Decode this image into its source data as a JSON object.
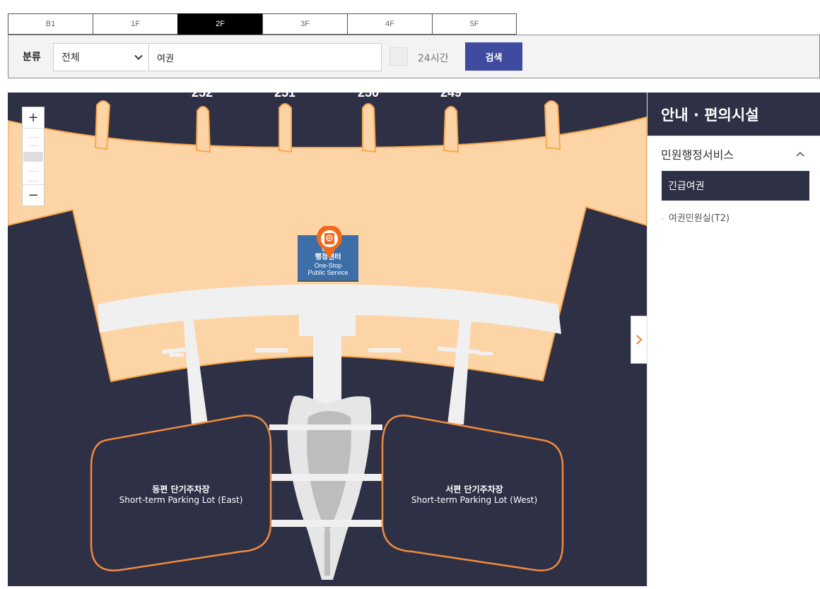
{
  "floors": [
    "B1",
    "1F",
    "2F",
    "3F",
    "4F",
    "5F"
  ],
  "active_floor": "2F",
  "search": {
    "label": "분류",
    "category": "전체",
    "query": "여권",
    "option_24h": "24시간",
    "button": "검색"
  },
  "map": {
    "zoom_in": "+",
    "zoom_out": "−",
    "gates": [
      "252",
      "251",
      "250",
      "249"
    ],
    "poi": {
      "name_ko_line1": "통합",
      "name_ko_line2": "행정센터",
      "name_en_line1": "One-Stop",
      "name_en_line2": "Public Service"
    },
    "parking_east": {
      "ko": "동편 단기주차장",
      "en": "Short-term Parking Lot (East)"
    },
    "parking_west": {
      "ko": "서편 단기주차장",
      "en": "Short-term Parking Lot (West)"
    },
    "colors": {
      "background": "#2e3046",
      "terminal": "#fdd4a6",
      "outline": "#f6a84f",
      "parking_outline": "#f08a3c",
      "road": "#f0f0f0",
      "marker": "#f06a1a"
    }
  },
  "sidebar": {
    "title": "안내 · 편의시설",
    "section": "민원행정서비스",
    "active_item": "긴급여권",
    "items": [
      "여권민원실(T2)"
    ]
  }
}
